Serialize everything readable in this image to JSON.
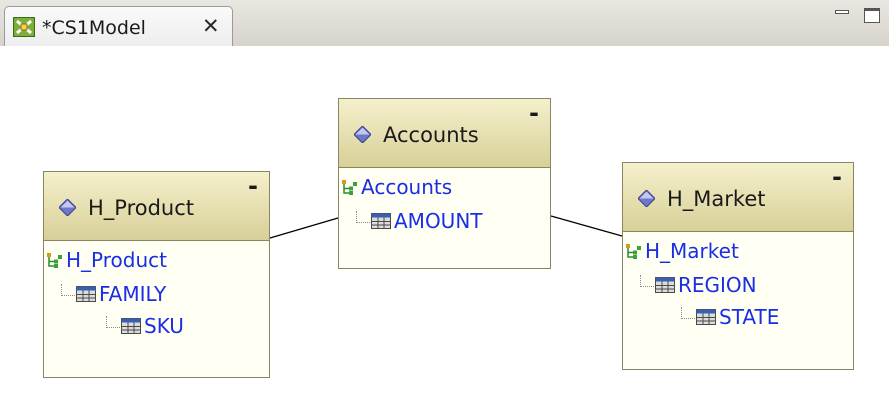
{
  "tab": {
    "title": "*CS1Model",
    "close_glyph": "✕",
    "icon": "model-diagram-icon"
  },
  "view_controls": {
    "minimize_icon": "minimize-icon",
    "maximize_icon": "maximize-icon"
  },
  "nodes": {
    "h_product": {
      "title": "H_Product",
      "collapse": "-",
      "hierarchy": "H_Product",
      "levels": [
        "FAMILY",
        "SKU"
      ]
    },
    "accounts": {
      "title": "Accounts",
      "collapse": "-",
      "hierarchy": "Accounts",
      "levels": [
        "AMOUNT"
      ]
    },
    "h_market": {
      "title": "H_Market",
      "collapse": "-",
      "hierarchy": "H_Market",
      "levels": [
        "REGION",
        "STATE"
      ]
    }
  },
  "colors": {
    "node_header_top": "#f4f0cc",
    "node_header_bottom": "#d8d098",
    "node_body": "#fffff3",
    "node_border": "#8a8460",
    "tree_label": "#1a2ee6",
    "gem": "#6f78c8"
  }
}
